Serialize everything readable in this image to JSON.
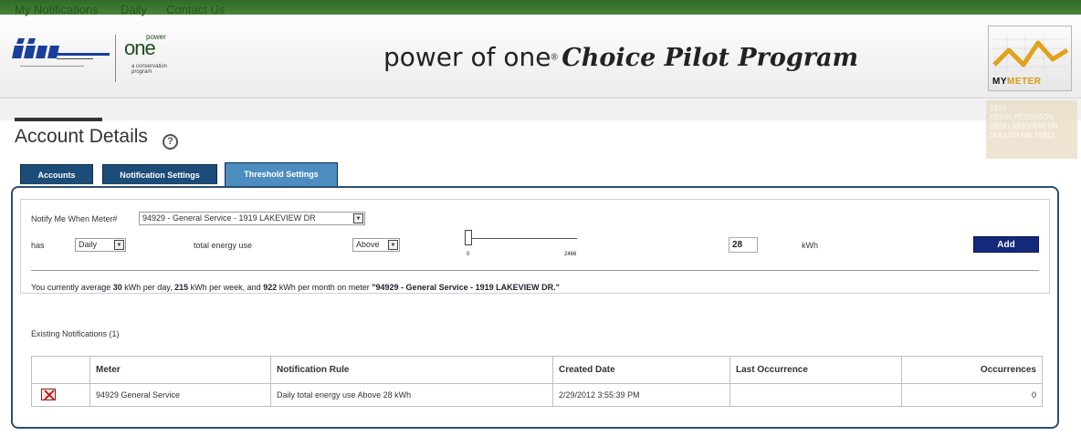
{
  "header": {
    "title_part1": "power of one",
    "title_tm": "®",
    "title_part2": "Choice Pilot Program",
    "poo_logo_small": "power",
    "poo_logo_word": "one",
    "poo_logo_sub": "a conservation program",
    "mymeter_label_prefix": "MY",
    "mymeter_label_brand": "METER"
  },
  "nav": {
    "items": [
      "My Notifications",
      "Daily",
      "Contact Us"
    ]
  },
  "page": {
    "title": "Account Details",
    "help_glyph": "?"
  },
  "address": {
    "lines": [
      "1919",
      "KEVIN PETERSON",
      "1919 LAKEVIEW DR",
      "DULUTH MN 55812"
    ]
  },
  "tabs": [
    {
      "label": "Accounts",
      "active": false
    },
    {
      "label": "Notification Settings",
      "active": false
    },
    {
      "label": "Threshold Settings",
      "active": true
    }
  ],
  "form": {
    "notify_label": "Notify Me When Meter#",
    "meter_select": "94929 - General Service - 1919 LAKEVIEW DR",
    "has_label": "has",
    "period_select": "Daily",
    "total_label": "total energy use",
    "comparison_select": "Above",
    "slider_min": "0",
    "slider_max": "2466",
    "slider_value_fraction": 0.0,
    "threshold_value": "28",
    "unit": "kWh",
    "add_label": "Add"
  },
  "average": {
    "prefix": "You currently average ",
    "day_value": "30",
    "day_text": " kWh per day, ",
    "week_value": "215",
    "week_text": " kWh per week, and ",
    "month_value": "922",
    "month_text": " kWh per month on meter ",
    "meter_text": "\"94929 - General Service - 1919 LAKEVIEW DR.\""
  },
  "existing": {
    "label": "Existing Notifications (1)",
    "columns": [
      "",
      "Meter",
      "Notification Rule",
      "Created Date",
      "Last Occurrence",
      "Occurrences"
    ],
    "rows": [
      {
        "meter": "94929 General Service",
        "rule": "Daily total energy use Above 28 kWh",
        "created": "2/29/2012 3:55:39 PM",
        "last": "",
        "occurrences": "0"
      }
    ]
  },
  "colors": {
    "top_bar": "#2f6a2a",
    "nav_link": "#1d5b1a",
    "tab": "#1c4c78",
    "tab_active": "#4d8dbf",
    "add_button": "#14297a",
    "panel_border": "#2d4e6e"
  },
  "icons": {
    "help": "help-icon",
    "delete": "delete-icon",
    "dropdown": "chevron-down-icon"
  }
}
